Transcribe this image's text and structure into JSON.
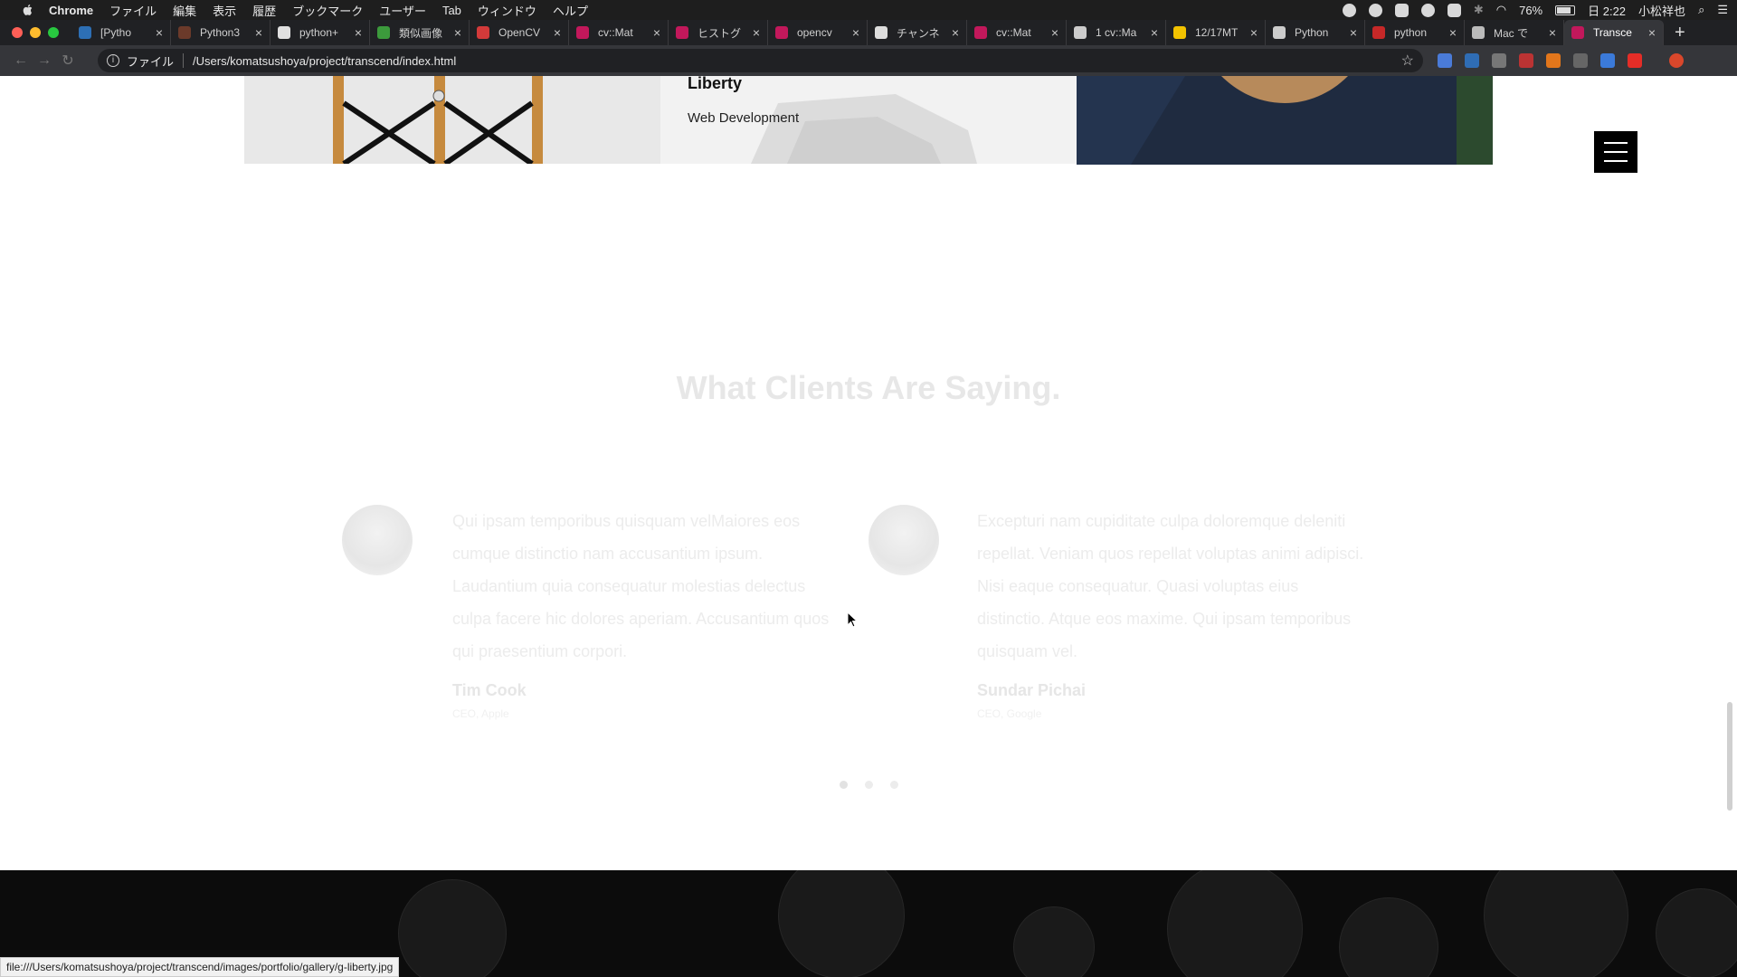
{
  "menubar": {
    "app": "Chrome",
    "items": [
      "ファイル",
      "編集",
      "表示",
      "履歴",
      "ブックマーク",
      "ユーザー",
      "Tab",
      "ウィンドウ",
      "ヘルプ"
    ],
    "battery": "76%",
    "clock": "日 2:22",
    "user": "小松祥也"
  },
  "tabs": [
    {
      "title": "[Pytho",
      "color": "#2d6fb5"
    },
    {
      "title": "Python3",
      "color": "#6b3a2a"
    },
    {
      "title": "python+",
      "color": "#e0e0e0"
    },
    {
      "title": "類似画像",
      "color": "#3c9a3c"
    },
    {
      "title": "OpenCV",
      "color": "#d33a3a"
    },
    {
      "title": "cv::Mat",
      "color": "#c2185b"
    },
    {
      "title": "ヒストグ",
      "color": "#c2185b"
    },
    {
      "title": "opencv",
      "color": "#c2185b"
    },
    {
      "title": "チャンネ",
      "color": "#dddddd"
    },
    {
      "title": "cv::Mat",
      "color": "#c2185b"
    },
    {
      "title": "1 cv::Ma",
      "color": "#cccccc"
    },
    {
      "title": "12/17MT",
      "color": "#f2c200"
    },
    {
      "title": "Python",
      "color": "#cccccc"
    },
    {
      "title": "python",
      "color": "#c62828"
    },
    {
      "title": "Mac で",
      "color": "#bbbbbb"
    },
    {
      "title": "Transce",
      "color": "#c2185b"
    }
  ],
  "toolbar": {
    "scheme_label": "ファイル",
    "url": "/Users/komatsushoya/project/transcend/index.html"
  },
  "gallery": {
    "title": "Liberty",
    "subtitle": "Web Development"
  },
  "section": {
    "title": "What Clients Are Saying."
  },
  "testimonials": [
    {
      "quote": "Qui ipsam temporibus quisquam velMaiores eos cumque distinctio nam accusantium ipsum. Laudantium quia consequatur molestias delectus culpa facere hic dolores aperiam. Accusantium quos qui praesentium corpori.",
      "name": "Tim Cook",
      "role": "CEO, Apple"
    },
    {
      "quote": "Excepturi nam cupiditate culpa doloremque deleniti repellat. Veniam quos repellat voluptas animi adipisci. Nisi eaque consequatur. Quasi voluptas eius distinctio. Atque eos maxime. Qui ipsam temporibus quisquam vel.",
      "name": "Sundar Pichai",
      "role": "CEO, Google"
    }
  ],
  "carousel": {
    "count": 3,
    "active": 0
  },
  "statusbar": "file:///Users/komatsushoya/project/transcend/images/portfolio/gallery/g-liberty.jpg"
}
